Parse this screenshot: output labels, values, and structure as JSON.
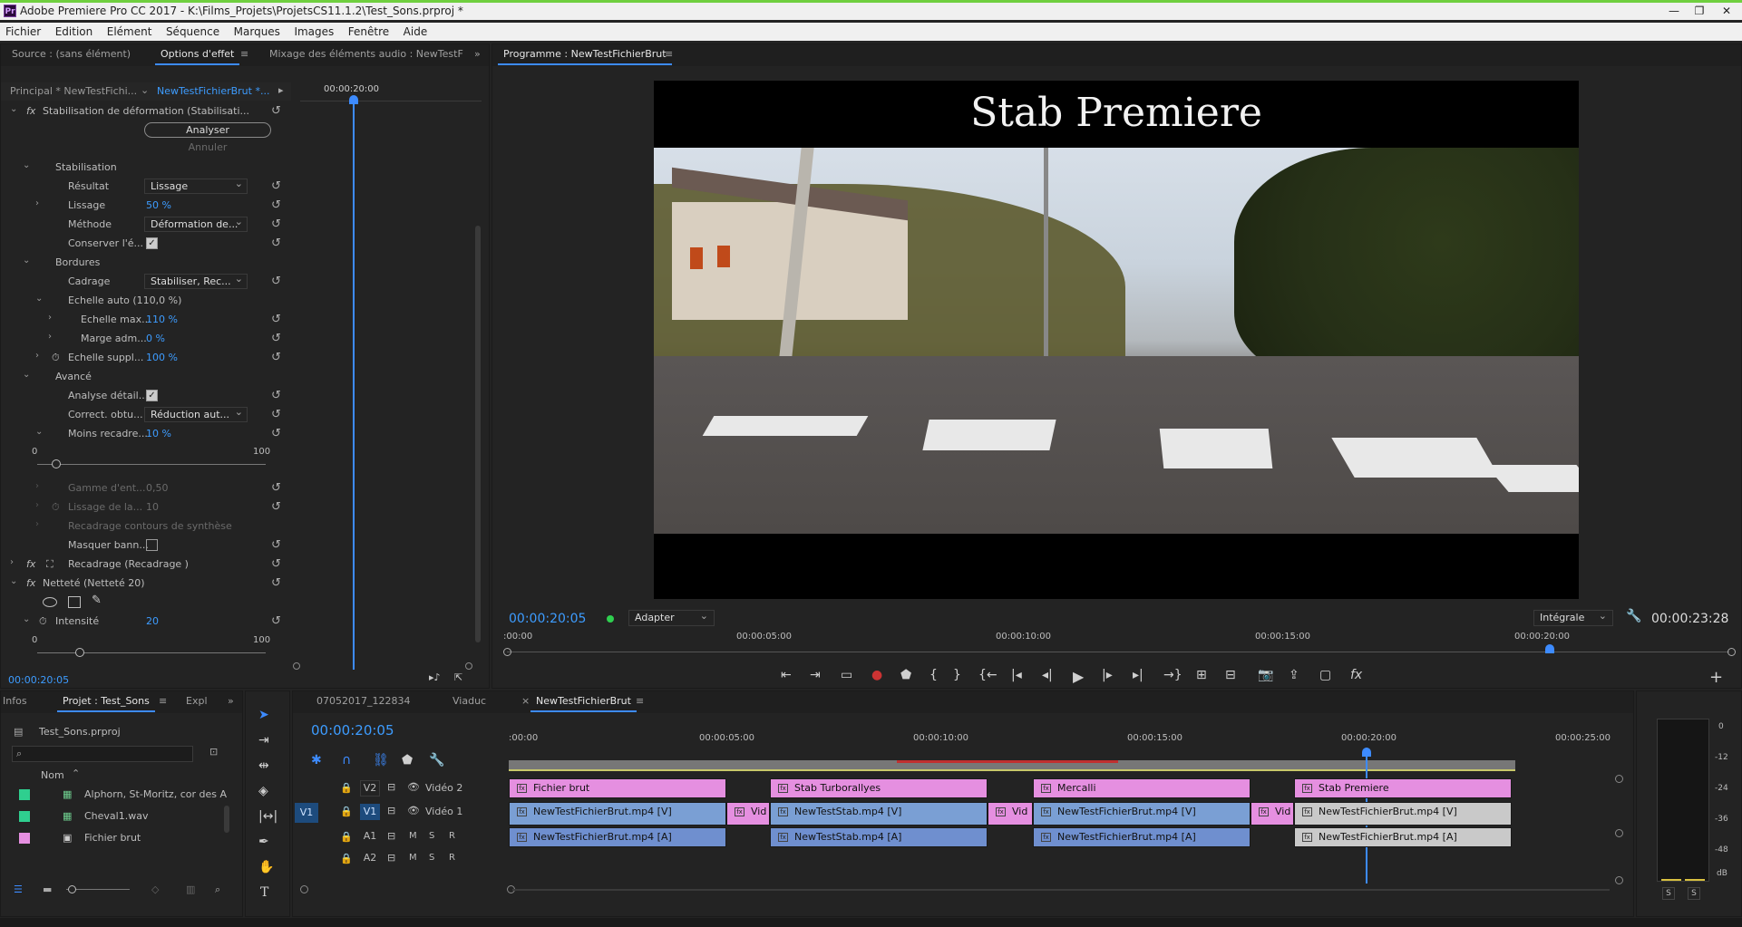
{
  "window": {
    "title": "Adobe Premiere Pro CC 2017 - K:\\Films_Projets\\ProjetsCS11.1.2\\Test_Sons.prproj *",
    "app_icon": "Pr"
  },
  "menu": [
    "Fichier",
    "Edition",
    "Elément",
    "Séquence",
    "Marques",
    "Images",
    "Fenêtre",
    "Aide"
  ],
  "effect_panel": {
    "tabs": [
      "Source : (sans élément)",
      "Options d'effet",
      "Mixage des éléments audio : NewTestF"
    ],
    "clip_selector": [
      "Principal * NewTestFichi...",
      "NewTestFichierBrut *..."
    ],
    "timecode_head": "00:00:20:00",
    "stab_effect": "Stabilisation de déformation (Stabilisati...",
    "analyse_btn": "Analyser",
    "annuler_btn": "Annuler",
    "section_stabilisation": "Stabilisation",
    "resultat_label": "Résultat",
    "resultat_value": "Lissage",
    "lissage_label": "Lissage",
    "lissage_value": "50 %",
    "methode_label": "Méthode",
    "methode_value": "Déformation de...",
    "conserver_label": "Conserver l'é...",
    "section_bordures": "Bordures",
    "cadrage_label": "Cadrage",
    "cadrage_value": "Stabiliser, Rec...",
    "echelle_auto_label": "Echelle auto (110,0 %)",
    "echelle_max_label": "Echelle max...",
    "echelle_max_value": "110 %",
    "marge_label": "Marge adm...",
    "marge_value": "0 %",
    "echelle_suppl_label": "Echelle suppl...",
    "echelle_suppl_value": "100 %",
    "section_avance": "Avancé",
    "analyse_detail_label": "Analyse détail...",
    "correct_label": "Correct. obtu...",
    "correct_value": "Réduction aut...",
    "moins_label": "Moins recadre...",
    "moins_value": "10 %",
    "slider1_min": "0",
    "slider1_max": "100",
    "gamme_label": "Gamme d'ent...",
    "gamme_value": "0,50",
    "lissage_la_label": "Lissage de la...",
    "lissage_la_value": "10",
    "recadrage_contours_label": "Recadrage contours de synthèse",
    "masquer_label": "Masquer bann...",
    "recadrage_effect": "Recadrage (Recadrage )",
    "nettete_effect": "Netteté (Netteté 20)",
    "intensite_label": "Intensité",
    "intensite_value": "20",
    "slider2_min": "0",
    "slider2_max": "100",
    "footer_timecode": "00:00:20:05"
  },
  "program_monitor": {
    "tab": "Programme : NewTestFichierBrut",
    "title_overlay": "Stab Premiere",
    "current_timecode": "00:00:20:05",
    "fit_dropdown": "Adapter",
    "quality_dropdown": "Intégrale",
    "duration": "00:00:23:28",
    "ruler_ticks": [
      ":00:00",
      "00:00:05:00",
      "00:00:10:00",
      "00:00:15:00",
      "00:00:20:00"
    ],
    "playhead_fraction": 0.853
  },
  "project_panel": {
    "tabs": [
      "Infos",
      "Projet : Test_Sons",
      "Expl"
    ],
    "project_file": "Test_Sons.prproj",
    "column_name": "Nom",
    "items": [
      {
        "name": "Alphorn, St-Moritz, cor des A",
        "color": "#2fcf8f"
      },
      {
        "name": "Cheval1.wav",
        "color": "#2fcf8f"
      },
      {
        "name": "Fichier brut",
        "color": "#e58fe0"
      }
    ]
  },
  "timeline": {
    "tabs": [
      "07052017_122834",
      "Viaduc",
      "NewTestFichierBrut"
    ],
    "timecode": "00:00:20:05",
    "ruler_ticks": [
      ":00:00",
      "00:00:05:00",
      "00:00:10:00",
      "00:00:15:00",
      "00:00:20:00",
      "00:00:25:00"
    ],
    "tracks": {
      "v2": {
        "id": "V2",
        "name": "Vidéo 2"
      },
      "v1": {
        "id": "V1",
        "name": "Vidéo 1",
        "src": "V1"
      },
      "a1": {
        "id": "A1"
      },
      "a2": {
        "id": "A2"
      },
      "m_label": "M",
      "s_label": "S",
      "r_label": "R"
    },
    "v2_clips": [
      "Fichier brut",
      "Stab Turborallyes",
      "Mercalli",
      "Stab Premiere"
    ],
    "v1_clips": [
      "NewTestFichierBrut.mp4 [V]",
      "Vid",
      "NewTestStab.mp4 [V]",
      "Vid",
      "NewTestFichierBrut.mp4 [V]",
      "Vid",
      "NewTestFichierBrut.mp4 [V]"
    ],
    "a1_clips": [
      "NewTestFichierBrut.mp4 [A]",
      "NewTestStab.mp4 [A]",
      "NewTestFichierBrut.mp4 [A]",
      "NewTestFichierBrut.mp4 [A]"
    ]
  },
  "audio_meter": {
    "scale": [
      "0",
      "-12",
      "-24",
      "-36",
      "-48",
      "dB"
    ],
    "solo_labels": [
      "S",
      "S"
    ]
  }
}
